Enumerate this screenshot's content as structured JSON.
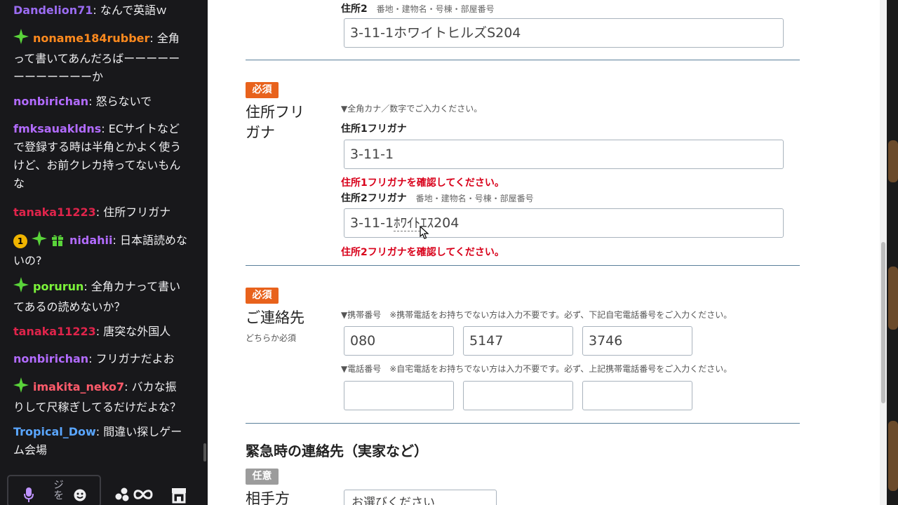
{
  "chat": {
    "messages": [
      {
        "user": "Dandelion71",
        "color": "#9b6cf2",
        "text": "なんで英語ｗ",
        "badges": []
      },
      {
        "user": "noname184rubber",
        "color": "#ff8a1e",
        "text": "全角って書いてあんだろばーーーーーーーーーーーーか",
        "badges": [
          "sparkle"
        ]
      },
      {
        "user": "nonbirichan",
        "color": "#b26bff",
        "text": "怒らないで",
        "badges": []
      },
      {
        "user": "fmksauakldns",
        "color": "#b26bff",
        "text": "ECサイトなどで登録する時は半角とかよく使うけど、お前クレカ持ってないもんな",
        "badges": []
      },
      {
        "user": "tanaka11223",
        "color": "#e0244b",
        "text": "住所フリガナ",
        "badges": []
      },
      {
        "user": "nidahii",
        "color": "#b26bff",
        "text": "日本語読めないの?",
        "badges": [
          "sub",
          "sparkle",
          "gift"
        ]
      },
      {
        "user": "porurun",
        "color": "#7cf33a",
        "text": "全角カナって書いてあるの読めないか？",
        "badges": [
          "sparkle"
        ]
      },
      {
        "user": "tanaka11223",
        "color": "#e0244b",
        "text": "唐突な外国人",
        "badges": []
      },
      {
        "user": "nonbirichan",
        "color": "#b26bff",
        "text": "フリガナだよお",
        "badges": []
      },
      {
        "user": "imakita_neko7",
        "color": "#ff5b6b",
        "text": "バカな振りして尺稼ぎしてるだけだよな？",
        "badges": [
          "sparkle"
        ]
      },
      {
        "user": "Tropical_Dow",
        "color": "#5aa6ff",
        "text": "間違い探しゲーム会場",
        "badges": []
      }
    ],
    "sub_badge_number": "1",
    "composer_placeholder": "ジを",
    "icons": {
      "mic": "microphone-icon",
      "emote": "emote-smiley-icon",
      "bits": "bits-icon",
      "channel_points": "infinity-points-icon",
      "store": "store-icon"
    }
  },
  "form": {
    "address2_top": {
      "label": "住所2",
      "hint": "番地・建物名・号棟・部屋番号",
      "value": "3-11-1ホワイトヒルズS204"
    },
    "furigana": {
      "badge": "必須",
      "title_line1": "住所フリ",
      "title_line2": "ガナ",
      "note": "▼全角カナ／数字でご入力ください。",
      "field1_label": "住所1フリガナ",
      "field1_value": "3-11-1",
      "field1_error": "住所1フリガナを確認してください。",
      "field2_label": "住所2フリガナ",
      "field2_hint": "番地・建物名・号棟・部屋番号",
      "field2_value_prefix": "3-11-1",
      "field2_value_ime": "ﾎﾜｲﾄ",
      "field2_value_suffix": "ｴｽ204",
      "field2_error": "住所2フリガナを確認してください。"
    },
    "contact": {
      "badge": "必須",
      "title": "ご連絡先",
      "subtitle": "どちらか必須",
      "mobile_note": "▼携帯番号　※携帯電話をお持ちでない方は入力不要です。必ず、下記自宅電話番号をご入力ください。",
      "mobile": [
        "080",
        "5147",
        "3746"
      ],
      "home_note": "▼電話番号　※自宅電話をお持ちでない方は入力不要です。必ず、上記携帯電話番号をご入力ください。",
      "home": [
        "",
        "",
        ""
      ]
    },
    "emergency": {
      "heading": "緊急時の連絡先（実家など）",
      "badge": "任意",
      "title": "相手方",
      "select_value": "お選びください"
    }
  },
  "colors": {
    "required": "#e8621c",
    "optional": "#9c9c9c",
    "error": "#d8001a",
    "divider": "#5a7f9a",
    "chat_bg": "#18181b"
  }
}
